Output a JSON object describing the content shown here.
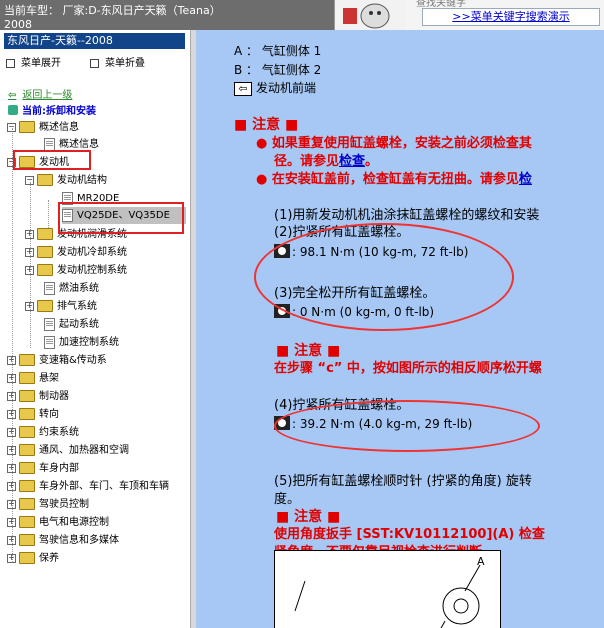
{
  "header": {
    "vehicle_line1": "当前车型：  厂家:D-东风日产天籁（Teana）",
    "vehicle_line2": "2008",
    "search_link": ">>菜单关键字搜索演示",
    "cut_text": "查找关键字"
  },
  "sidebar": {
    "doc_title": "东风日产-天籁--2008",
    "expand_menu": "菜单展开",
    "collapse_menu": "菜单折叠",
    "back_link": "返回上一级",
    "current": "当前:拆卸和安装",
    "tree": [
      {
        "label": "概述信息",
        "type": "folder",
        "expanded": true
      },
      {
        "label": "概述信息",
        "type": "page"
      },
      {
        "label": "发动机",
        "type": "folder",
        "expanded": true
      },
      {
        "label": "发动机结构",
        "type": "folder",
        "expanded": true
      },
      {
        "label": "MR20DE",
        "type": "page"
      },
      {
        "label": "VQ25DE、VQ35DE",
        "type": "page",
        "selected": true
      },
      {
        "label": "发动机润滑系统",
        "type": "folder"
      },
      {
        "label": "发动机冷却系统",
        "type": "folder"
      },
      {
        "label": "发动机控制系统",
        "type": "folder"
      },
      {
        "label": "燃油系统",
        "type": "page"
      },
      {
        "label": "排气系统",
        "type": "folder"
      },
      {
        "label": "起动系统",
        "type": "page"
      },
      {
        "label": "加速控制系统",
        "type": "page"
      },
      {
        "label": "变速箱&传动系",
        "type": "folder"
      },
      {
        "label": "悬架",
        "type": "folder"
      },
      {
        "label": "制动器",
        "type": "folder"
      },
      {
        "label": "转向",
        "type": "folder"
      },
      {
        "label": "约束系统",
        "type": "folder"
      },
      {
        "label": "通风、加热器和空调",
        "type": "folder"
      },
      {
        "label": "车身内部",
        "type": "folder"
      },
      {
        "label": "车身外部、车门、车顶和车辆",
        "type": "folder"
      },
      {
        "label": "驾驶员控制",
        "type": "folder"
      },
      {
        "label": "电气和电源控制",
        "type": "folder"
      },
      {
        "label": "驾驶信息和多媒体",
        "type": "folder"
      },
      {
        "label": "保养",
        "type": "folder"
      }
    ]
  },
  "content": {
    "legend_a": "A ： 气缸侧体 1",
    "legend_b": "B ： 气缸侧体 2",
    "legend_front": "发动机前端",
    "note_title": "■ 注意 ■",
    "note1_text": "如果重复使用缸盖螺栓，安装之前必须检查其",
    "note1_text2": "径。请参见",
    "note1_link": "检查",
    "note2_text": "在安装缸盖前，检查缸盖有无扭曲。请参见",
    "note2_link": "检",
    "step1": "(1)用新发动机机油涂抹缸盖螺栓的螺纹和安装",
    "step2": "(2)拧紧所有缸盖螺栓。",
    "torque1": ": 98.1 N·m (10 kg-m, 72 ft-lb)",
    "step3": "(3)完全松开所有缸盖螺栓。",
    "torque2": ": 0 N·m (0 kg-m, 0 ft-lb)",
    "note3_title": "■ 注意 ■",
    "note3_line1": "在步骤 “c” 中，按如图所示的相反顺序松开螺",
    "step4": "(4)拧紧所有缸盖螺栓。",
    "torque3": ": 39.2 N·m (4.0 kg-m, 29 ft-lb)",
    "step5_line1": "(5)把所有缸盖螺栓顺时针 (拧紧的角度) 旋转",
    "step5_line2": "度。",
    "note4_title": "■ 注意 ■",
    "note4_line1": "使用角度扳手 [SST:KV10112100](A) 检查",
    "note4_line2": "紧角度。不要仅靠目视检查进行判断。",
    "figure_label": "A"
  },
  "colors": {
    "pane_bg": "#a7c8f4",
    "warning": "#e00000",
    "title_bar": "#114488",
    "annotation": "#e33333"
  }
}
